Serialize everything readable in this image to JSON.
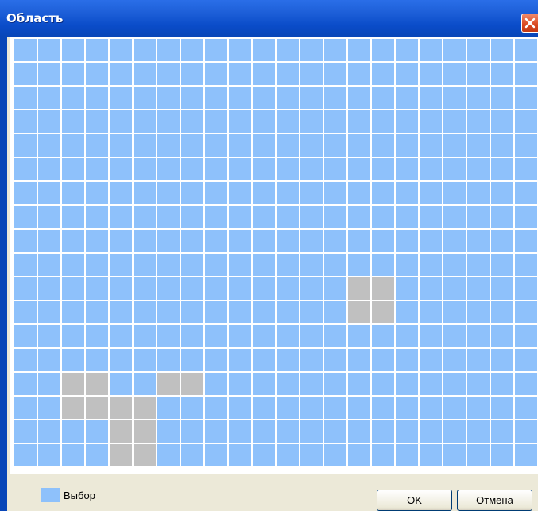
{
  "window": {
    "title": "Область",
    "close_icon": "close-icon"
  },
  "grid": {
    "columns": 22,
    "rows": 18,
    "selected_color": "#8ec1fb",
    "unselected_color": "#c0c0c0",
    "unselected_cells": [
      [
        10,
        14
      ],
      [
        11,
        14
      ],
      [
        10,
        15
      ],
      [
        11,
        15
      ],
      [
        14,
        2
      ],
      [
        15,
        2
      ],
      [
        14,
        3
      ],
      [
        15,
        3
      ],
      [
        15,
        4
      ],
      [
        16,
        4
      ],
      [
        17,
        4
      ],
      [
        18,
        4
      ],
      [
        15,
        5
      ],
      [
        16,
        5
      ],
      [
        17,
        5
      ],
      [
        18,
        5
      ],
      [
        14,
        6
      ],
      [
        18,
        6
      ],
      [
        14,
        7
      ]
    ]
  },
  "legend": {
    "label": "Выбор",
    "color": "#8ec1fb"
  },
  "buttons": {
    "ok_label": "OK",
    "cancel_label": "Отмена"
  }
}
